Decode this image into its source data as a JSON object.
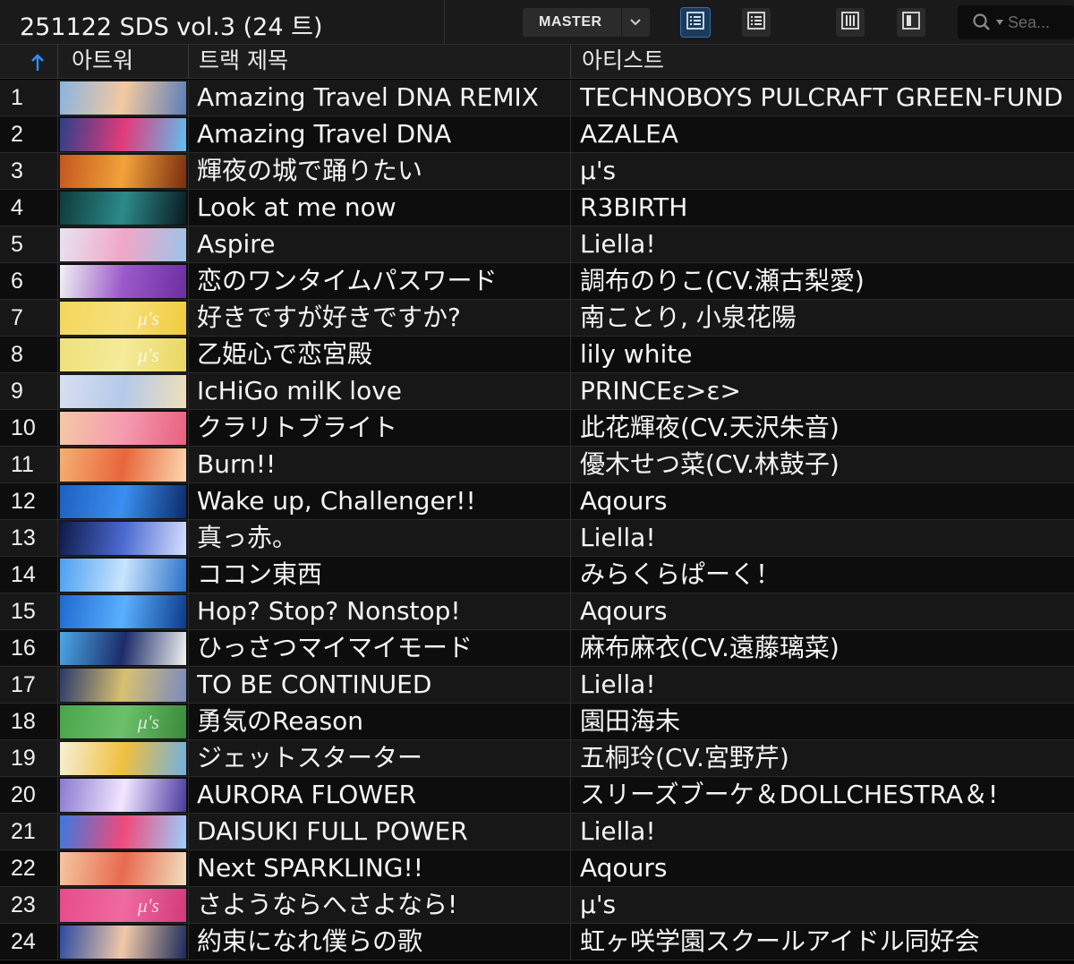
{
  "toolbar": {
    "playlist_title": "251122 SDS vol.3 (24 트)",
    "difficulty": "MASTER",
    "search_placeholder": "Sea..."
  },
  "columns": {
    "number": "",
    "artwork": "아트워",
    "title": "트랙 제목",
    "artist": "아티스트"
  },
  "colors": {
    "background": "#000000",
    "row_odd": "#171717",
    "row_even": "#0d0d0d",
    "accent_blue": "#2f8fff"
  },
  "tracks": [
    {
      "no": "1",
      "title": "Amazing Travel DNA REMIX",
      "artist": "TECHNOBOYS PULCRAFT GREEN-FUND",
      "art": [
        "#8ab4e0",
        "#f3c9a0",
        "#5c7fb8"
      ]
    },
    {
      "no": "2",
      "title": "Amazing Travel DNA",
      "artist": "AZALEA",
      "art": [
        "#2d3f8a",
        "#e23b7a",
        "#5ec0f0"
      ]
    },
    {
      "no": "3",
      "title": "輝夜の城で踊りたい",
      "artist": "μ's",
      "art": [
        "#c4561f",
        "#f2a23a",
        "#7a2c10"
      ]
    },
    {
      "no": "4",
      "title": "Look at me now",
      "artist": "R3BIRTH",
      "art": [
        "#0f3a3a",
        "#2d8a8a",
        "#0a1a20"
      ]
    },
    {
      "no": "5",
      "title": "Aspire",
      "artist": "Liella!",
      "art": [
        "#e7e3f2",
        "#f0a7c6",
        "#9bc4ea"
      ]
    },
    {
      "no": "6",
      "title": "恋のワンタイムパスワード",
      "artist": "調布のりこ(CV.瀬古梨愛)",
      "art": [
        "#f2f2f2",
        "#9b59c9",
        "#6b2fa0"
      ]
    },
    {
      "no": "7",
      "title": "好きですが好きですか?",
      "artist": "南ことり, 小泉花陽",
      "art": [
        "#f3d65a",
        "#f6e07a",
        "#f0cc3c"
      ],
      "mu": true
    },
    {
      "no": "8",
      "title": "乙姫心で恋宮殿",
      "artist": "lily white",
      "art": [
        "#efe07a",
        "#f5eb9a",
        "#e8d760"
      ],
      "mu": true
    },
    {
      "no": "9",
      "title": "IcHiGo milK love",
      "artist": "PRINCEε>ε>",
      "art": [
        "#d9dff0",
        "#b5c9ea",
        "#f0e0b8"
      ]
    },
    {
      "no": "10",
      "title": "クラリトブライト",
      "artist": "此花輝夜(CV.天沢朱音)",
      "art": [
        "#f4c9a4",
        "#f59bb0",
        "#e86080"
      ]
    },
    {
      "no": "11",
      "title": "Burn!!",
      "artist": "優木せつ菜(CV.林鼓子)",
      "art": [
        "#f4b070",
        "#e8663c",
        "#fbd8b0"
      ]
    },
    {
      "no": "12",
      "title": "Wake up, Challenger!!",
      "artist": "Aqours",
      "art": [
        "#1f5fc0",
        "#3a8ff0",
        "#0c2a6a"
      ]
    },
    {
      "no": "13",
      "title": "真っ赤。",
      "artist": "Liella!",
      "art": [
        "#0f1a4a",
        "#4a6ad0",
        "#d8e0ff"
      ]
    },
    {
      "no": "14",
      "title": "ココン東西",
      "artist": "みらくらぱーく！",
      "art": [
        "#4aa0f0",
        "#c8e4ff",
        "#2a70c8"
      ]
    },
    {
      "no": "15",
      "title": "Hop? Stop? Nonstop!",
      "artist": "Aqours",
      "art": [
        "#1e6ad0",
        "#5ab0ff",
        "#0d3a8a"
      ]
    },
    {
      "no": "16",
      "title": "ひっさつマイマイモード",
      "artist": "麻布麻衣(CV.遠藤璃菜)",
      "art": [
        "#4aa8e8",
        "#1c2c6a",
        "#f2f2f2"
      ]
    },
    {
      "no": "17",
      "title": "TO BE CONTINUED",
      "artist": "Liella!",
      "art": [
        "#2a3a6a",
        "#d8c070",
        "#7a8ac0"
      ]
    },
    {
      "no": "18",
      "title": "勇気のReason",
      "artist": "園田海未",
      "art": [
        "#49a54a",
        "#6cc06a",
        "#3a8a3a"
      ],
      "mu": true
    },
    {
      "no": "19",
      "title": "ジェットスターター",
      "artist": "五桐玲(CV.宮野芹)",
      "art": [
        "#f6f0d8",
        "#f0c040",
        "#70b0e0"
      ]
    },
    {
      "no": "20",
      "title": "AURORA FLOWER",
      "artist": "スリーズブーケ＆DOLLCHESTRA＆!",
      "art": [
        "#8a7ad0",
        "#f2e6ff",
        "#4a3aa0"
      ]
    },
    {
      "no": "21",
      "title": "DAISUKI FULL POWER",
      "artist": "Liella!",
      "art": [
        "#3a7ae0",
        "#f04a7a",
        "#9ad0ff"
      ]
    },
    {
      "no": "22",
      "title": "Next SPARKLING!!",
      "artist": "Aqours",
      "art": [
        "#f4c8a0",
        "#e86a50",
        "#f0e0c0"
      ]
    },
    {
      "no": "23",
      "title": "さようならへさよなら!",
      "artist": "μ's",
      "art": [
        "#e84a8a",
        "#f06aa0",
        "#d23a7a"
      ],
      "mu": true
    },
    {
      "no": "24",
      "title": "約束になれ僕らの歌",
      "artist": "虹ヶ咲学園スクールアイドル同好会",
      "art": [
        "#2a4aa0",
        "#f0c8a8",
        "#1a2a5a"
      ]
    }
  ]
}
